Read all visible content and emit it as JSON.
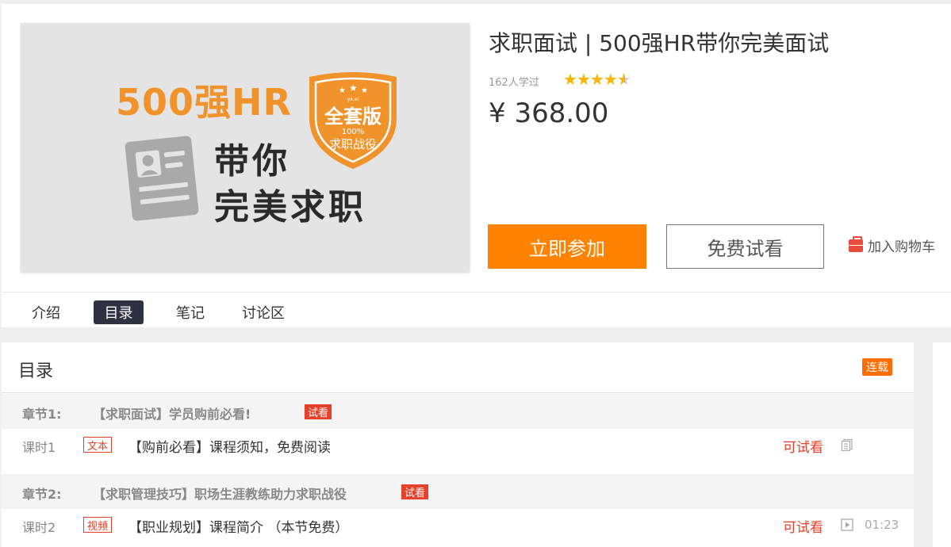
{
  "cover": {
    "line1": "500强HR",
    "line2": "带你",
    "line3": "完美求职",
    "badge_main": "全套版",
    "badge_pct": "100%",
    "badge_sub": "求职战役",
    "badge_small": "yx.ai"
  },
  "course": {
    "title": "求职面试 | 500强HR带你完美面试",
    "learners": "162人学过",
    "rating": 4.6,
    "price": "¥ 368.00"
  },
  "actions": {
    "join_label": "立即参加",
    "trial_label": "免费试看",
    "cart_label": "加入购物车"
  },
  "tabs": [
    {
      "label": "介绍"
    },
    {
      "label": "目录"
    },
    {
      "label": "笔记"
    },
    {
      "label": "讨论区"
    }
  ],
  "active_tab": "目录",
  "toc": {
    "title": "目录",
    "serial_badge": "连载",
    "chapters": [
      {
        "label": "章节1:",
        "title": "【求职面试】学员购前必看!",
        "tag": "试看",
        "lessons": [
          {
            "label": "课时1",
            "type": "文本",
            "title": "【购前必看】课程须知，免费阅读",
            "preview": "可试看",
            "icon": "document-icon",
            "duration": ""
          }
        ]
      },
      {
        "label": "章节2:",
        "title": "【求职管理技巧】职场生涯教练助力求职战役",
        "tag": "试看",
        "lessons": [
          {
            "label": "课时2",
            "type": "视频",
            "title": "【职业规划】课程简介 （本节免费）",
            "preview": "可试看",
            "icon": "video-play-icon",
            "duration": "01:23"
          }
        ]
      }
    ]
  },
  "colors": {
    "primary_orange": "#ff8200",
    "red_accent": "#e8412b",
    "star": "#f7b500",
    "active_tab_bg": "#2d3142"
  }
}
